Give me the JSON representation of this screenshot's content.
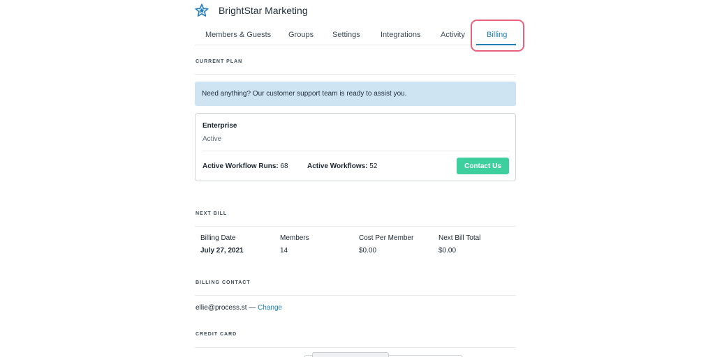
{
  "header": {
    "org_name": "BrightStar Marketing",
    "logo_icon": "star-logo-icon"
  },
  "tabs": [
    {
      "label": "Members & Guests",
      "active": false
    },
    {
      "label": "Groups",
      "active": false
    },
    {
      "label": "Settings",
      "active": false
    },
    {
      "label": "Integrations",
      "active": false
    },
    {
      "label": "Activity",
      "active": false
    },
    {
      "label": "Billing",
      "active": true
    }
  ],
  "current_plan": {
    "section_label": "CURRENT PLAN",
    "support_message": "Need anything? Our customer support team is ready to assist you.",
    "plan_name": "Enterprise",
    "plan_status": "Active",
    "runs_label": "Active Workflow Runs:",
    "runs_value": "68",
    "workflows_label": "Active Workflows:",
    "workflows_value": "52",
    "contact_button": "Contact Us"
  },
  "next_bill": {
    "section_label": "NEXT BILL",
    "columns": [
      {
        "header": "Billing Date",
        "value": "July 27, 2021"
      },
      {
        "header": "Members",
        "value": "14"
      },
      {
        "header": "Cost Per Member",
        "value": "$0.00"
      },
      {
        "header": "Next Bill Total",
        "value": "$0.00"
      }
    ]
  },
  "billing_contact": {
    "section_label": "BILLING CONTACT",
    "email": "ellie@process.st",
    "separator": " — ",
    "change_link": "Change"
  },
  "credit_card": {
    "section_label": "CREDIT CARD"
  },
  "colors": {
    "accent": "#1f7fb7",
    "highlight": "#e8627e",
    "button": "#3ecf9f",
    "banner": "#cfe4f3"
  }
}
